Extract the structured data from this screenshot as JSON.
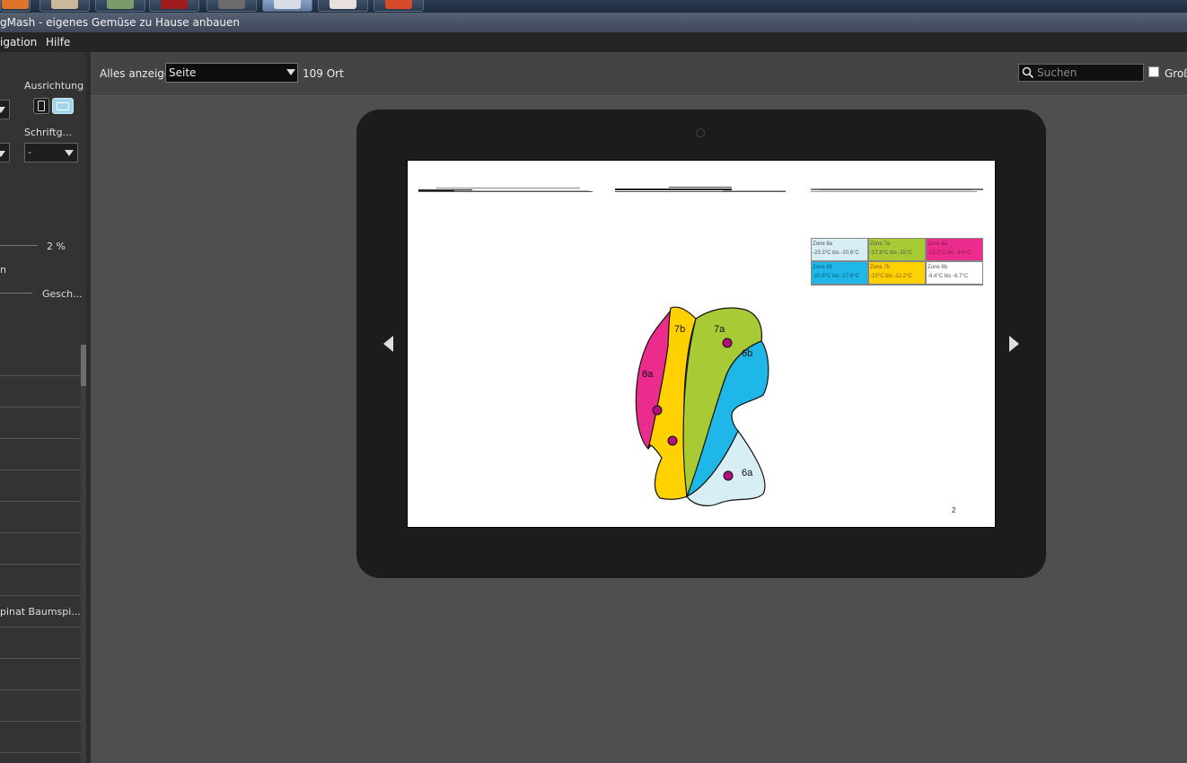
{
  "window": {
    "title": "gMash - eigenes Gemüse zu Hause anbauen"
  },
  "menu": {
    "items": [
      "igation",
      "Hilfe"
    ]
  },
  "sidebar": {
    "orientation_label": "Ausrichtung",
    "font_label": "Schriftg...",
    "font_value": "-",
    "percent_value": "2 %",
    "cut_text": "n",
    "gesch_label": "Gesch...",
    "list_item_text": "pinat Baumspi..."
  },
  "toolbar": {
    "show_all_label": "Alles anzeigen",
    "view_select_value": "Seite",
    "location_label": "109 Ort",
    "search_placeholder": "Suchen",
    "checkbox_label": "Groß"
  },
  "page": {
    "number": "2",
    "zones": [
      {
        "name": "Zone 6a",
        "range": "-23.3°C bis -20.6°C",
        "color": "#d7eef5"
      },
      {
        "name": "Zone 7a",
        "range": "-17.8°C bis -15°C",
        "color": "#a7ca35"
      },
      {
        "name": "Zone 8a",
        "range": "-12.2°C bis -9.4°C",
        "color": "#ec2c8c"
      },
      {
        "name": "Zone 6b",
        "range": "-20.6°C bis -17.8°C",
        "color": "#1eb7e8"
      },
      {
        "name": "Zone 7b",
        "range": "-15°C bis -12.2°C",
        "color": "#ffd100"
      },
      {
        "name": "Zone 8b",
        "range": "-9.4°C bis -6.7°C",
        "color": "#ffffff"
      }
    ],
    "map_labels": {
      "z8a": "8a",
      "z7b": "7b",
      "z7a": "7a",
      "z6b": "6b",
      "z6a": "6a"
    }
  }
}
